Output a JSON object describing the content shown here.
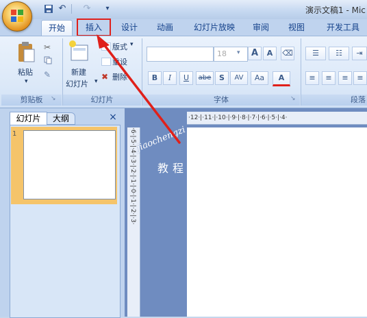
{
  "window": {
    "title": "演示文稿1 - Mic"
  },
  "quick_access": {
    "icons": [
      "save-icon",
      "undo-icon",
      "redo-icon",
      "customize-icon"
    ]
  },
  "tabs": [
    {
      "label": "开始",
      "active": true
    },
    {
      "label": "插入",
      "highlighted": true
    },
    {
      "label": "设计"
    },
    {
      "label": "动画"
    },
    {
      "label": "幻灯片放映"
    },
    {
      "label": "审阅"
    },
    {
      "label": "视图"
    },
    {
      "label": "开发工具"
    }
  ],
  "ribbon": {
    "clipboard": {
      "label": "剪贴板",
      "paste": "粘贴"
    },
    "slides": {
      "label": "幻灯片",
      "new_slide_line1": "新建",
      "new_slide_line2": "幻灯片",
      "layout": "版式",
      "reset": "重设",
      "delete": "删除"
    },
    "font": {
      "label": "字体",
      "font_name": "",
      "font_size": "18",
      "bold": "B",
      "italic": "I",
      "underline": "U",
      "strike": "abe",
      "shadow": "S",
      "spacing": "AV",
      "case": "Aa",
      "color": "A",
      "grow": "A",
      "shrink": "A"
    },
    "paragraph": {
      "label": "段落"
    }
  },
  "panel": {
    "tab_slides": "幻灯片",
    "tab_outline": "大纲",
    "close": "×",
    "slide_number": "1"
  },
  "ruler": {
    "horizontal": "·12·|·11·|·10·|·9·|·8·|·7·|·6·|·5·|·4·",
    "vertical": "·6·|·5·|·4·|·3·|·2·|·1·|·0·|·1·|·2·|·3·"
  },
  "watermark": {
    "line1": "jiaochengzi",
    "line2": "教程"
  },
  "annotation": {
    "color": "#e0201a"
  },
  "colors": {
    "accent_red": "#e0201a",
    "ribbon": "#dbe8f8",
    "workspace": "#6f8cc0"
  }
}
